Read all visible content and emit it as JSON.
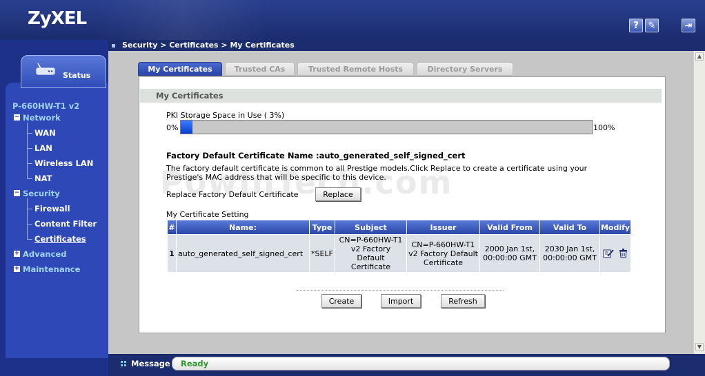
{
  "header": {
    "logo": "ZyXEL",
    "help_icon_glyph": "?",
    "wizard_icon_glyph": "✎",
    "logout_icon_glyph": "⇥"
  },
  "breadcrumb": "Security > Certificates > My Certificates",
  "sidebar": {
    "status_label": "Status",
    "device_name": "P-660HW-T1 v2",
    "groups": {
      "network": {
        "label": "Network",
        "items": [
          "WAN",
          "LAN",
          "Wireless LAN",
          "NAT"
        ]
      },
      "security": {
        "label": "Security",
        "items": [
          "Firewall",
          "Content Filter",
          "Certificates"
        ]
      },
      "advanced": {
        "label": "Advanced"
      },
      "maintenance": {
        "label": "Maintenance"
      }
    },
    "expanded_sign": "−",
    "collapsed_sign": "+"
  },
  "tabs": [
    "My Certificates",
    "Trusted CAs",
    "Trusted Remote Hosts",
    "Directory Servers"
  ],
  "section_title": "My Certificates",
  "pki": {
    "label": "PKI Storage Space in Use ( 3%)",
    "min_label": "0%",
    "max_label": "100%",
    "percent": 3
  },
  "factory": {
    "title": "Factory Default Certificate Name :auto_generated_self_signed_cert",
    "description": "The factory default certificate is common to all Prestige models.Click Replace to create a certificate using your Prestige's MAC address that will be specific to this device.",
    "replace_label": "Replace Factory Default Certificate",
    "replace_button": "Replace"
  },
  "watermark": "PowInTech.com",
  "setting_label": "My Certificate Setting",
  "table": {
    "headers": [
      "#",
      "Name:",
      "Type",
      "Subject",
      "Issuer",
      "Valid From",
      "Valid To",
      "Modify"
    ],
    "rows": [
      {
        "index": "1",
        "name": "auto_generated_self_signed_cert",
        "type": "*SELF",
        "subject": "CN=P-660HW-T1 v2 Factory Default Certificate",
        "issuer": "CN=P-660HW-T1 v2 Factory Default Certificate",
        "valid_from": "2000 Jan 1st, 00:00:00 GMT",
        "valid_to": "2030 Jan 1st, 00:00:00 GMT"
      }
    ]
  },
  "actions": {
    "create": "Create",
    "import": "Import",
    "refresh": "Refresh"
  },
  "message": {
    "label": "Message",
    "value": "Ready"
  },
  "colors": {
    "header_bg": "#1b2c6f",
    "sidebar_bg": "#1e318a",
    "nav_group": "#9fd4ff",
    "tab_active": "#2b45a8",
    "status_ok": "#2a9a2a"
  }
}
